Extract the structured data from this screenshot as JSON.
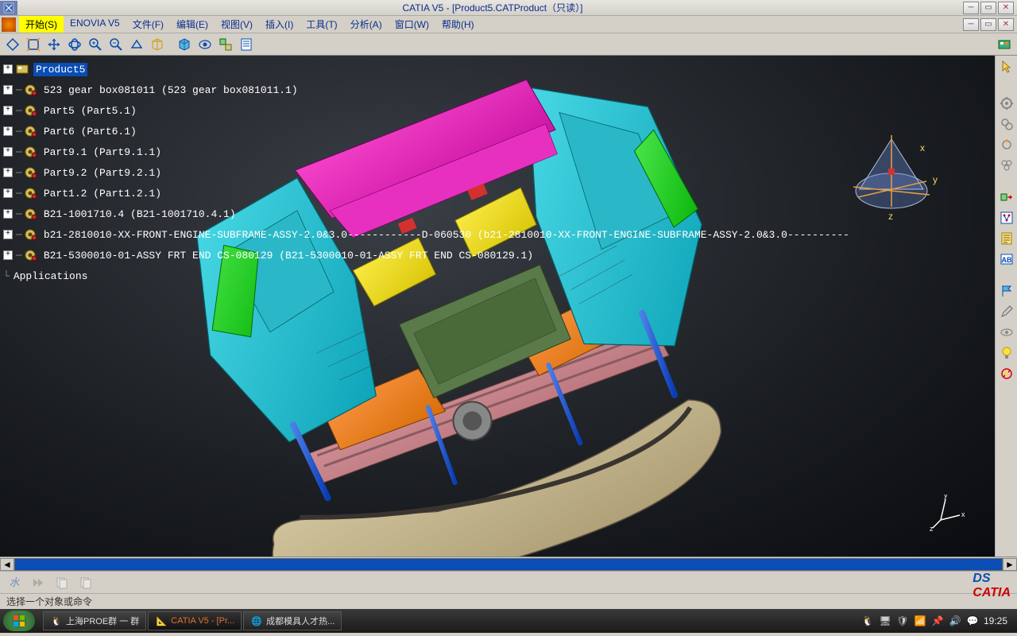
{
  "window": {
    "title": "CATIA V5 - [Product5.CATProduct（只读）]"
  },
  "menubar": {
    "start": "开始(S)",
    "items": [
      "ENOVIA V5",
      "文件(F)",
      "编辑(E)",
      "视图(V)",
      "插入(I)",
      "工具(T)",
      "分析(A)",
      "窗口(W)",
      "帮助(H)"
    ]
  },
  "tree": {
    "root": "Product5",
    "nodes": [
      "523 gear box081011 (523 gear box081011.1)",
      "Part5 (Part5.1)",
      "Part6 (Part6.1)",
      "Part9.1 (Part9.1.1)",
      "Part9.2 (Part9.2.1)",
      "Part1.2 (Part1.2.1)",
      "B21-1001710.4 (B21-1001710.4.1)",
      "b21-2810010-XX-FRONT-ENGINE-SUBFRAME-ASSY-2.0&3.0------------D-060530 (b21-2810010-XX-FRONT-ENGINE-SUBFRAME-ASSY-2.0&3.0----------",
      "B21-5300010-01-ASSY FRT END CS-080129 (B21-5300010-01-ASSY FRT END CS-080129.1)"
    ],
    "applications": "Applications"
  },
  "compass": {
    "x": "x",
    "y": "y",
    "z": "z"
  },
  "logo": {
    "brand_prefix": "DS",
    "brand": "CATIA"
  },
  "statusbar": {
    "prompt": "选择一个对象或命令"
  },
  "taskbar": {
    "items": [
      {
        "label": "上海PROE群 一 群",
        "color": "#ddd"
      },
      {
        "label": "CATIA V5 - [Pr...",
        "color": "#e07030"
      },
      {
        "label": "成都模具人才热...",
        "color": "#ddd"
      }
    ],
    "clock": "19:25"
  }
}
